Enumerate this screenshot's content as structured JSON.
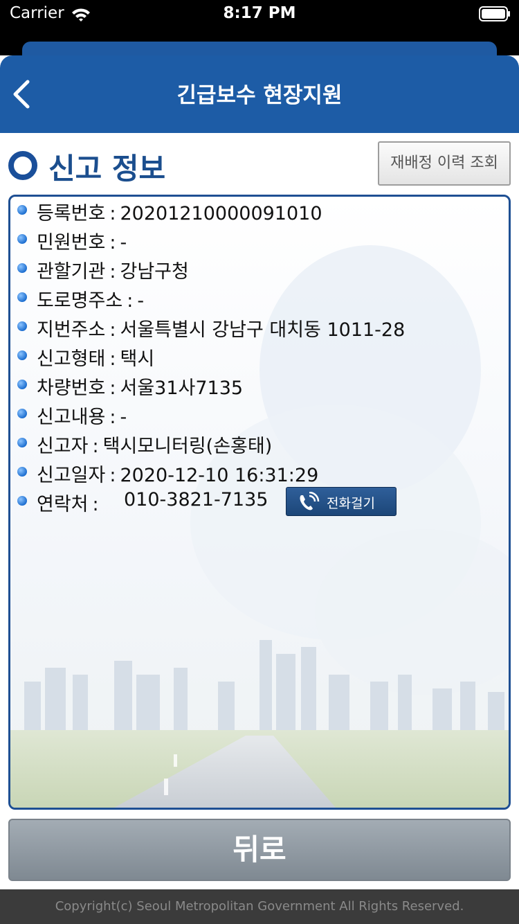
{
  "status_bar": {
    "carrier": "Carrier",
    "time": "8:17 PM"
  },
  "header": {
    "title": "긴급보수 현장지원",
    "back_icon": "chevron-left-icon"
  },
  "section": {
    "title": "신고 정보",
    "history_button": "재배정 이력 조회"
  },
  "info_rows": [
    {
      "label": "등록번호",
      "value": "20201210000091010"
    },
    {
      "label": "민원번호",
      "value": "-"
    },
    {
      "label": "관할기관",
      "value": "강남구청"
    },
    {
      "label": "도로명주소",
      "value": "-"
    },
    {
      "label": "지번주소",
      "value": "서울특별시 강남구 대치동 1011-28"
    },
    {
      "label": "신고형태",
      "value": "택시"
    },
    {
      "label": "차량번호",
      "value": "서울31사7135"
    },
    {
      "label": "신고내용",
      "value": "-"
    },
    {
      "label": "신고자",
      "value": "택시모니터링(손홍태)"
    },
    {
      "label": "신고일자",
      "value": "2020-12-10 16:31:29"
    }
  ],
  "contact": {
    "label": "연락처",
    "value": "010-3821-7135",
    "call_button": "전화걸기"
  },
  "bottom_button": "뒤로",
  "footer": "Copyright(c) Seoul Metropolitan Government All Rights Reserved.",
  "colors": {
    "nav_blue": "#1d5ca6",
    "title_blue": "#1b4e8e",
    "panel_border": "#1e4f93",
    "footer_bg": "#3b3b3b"
  }
}
